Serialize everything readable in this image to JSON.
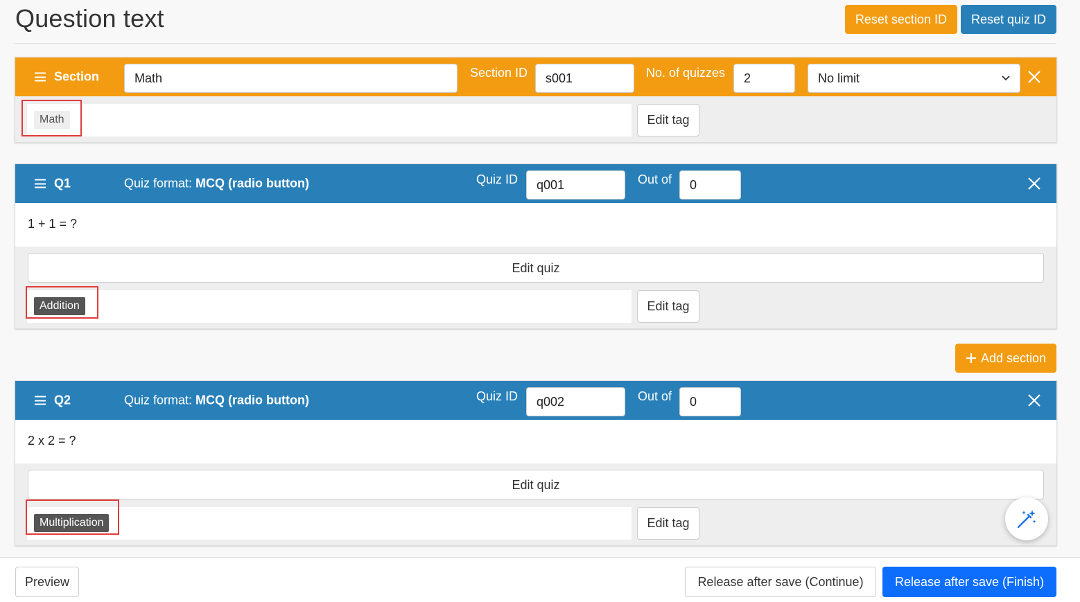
{
  "header": {
    "title": "Question text",
    "reset_section_label": "Reset section ID",
    "reset_quiz_label": "Reset quiz ID"
  },
  "section": {
    "label": "Section",
    "name_value": "Math",
    "section_id_label": "Section ID",
    "section_id_value": "s001",
    "num_quizzes_label": "No. of quizzes",
    "num_quizzes_value": "2",
    "limit_selected": "No limit",
    "tag": "Math",
    "edit_tag_label": "Edit tag"
  },
  "quizzes": [
    {
      "label": "Q1",
      "format_prefix": "Quiz format: ",
      "format_value": "MCQ (radio button)",
      "quiz_id_label": "Quiz ID",
      "quiz_id_value": "q001",
      "out_of_label": "Out of",
      "out_of_value": "0",
      "question": "1 + 1 = ?",
      "edit_quiz_label": "Edit quiz",
      "tag": "Addition",
      "edit_tag_label": "Edit tag"
    },
    {
      "label": "Q2",
      "format_prefix": "Quiz format: ",
      "format_value": "MCQ (radio button)",
      "quiz_id_label": "Quiz ID",
      "quiz_id_value": "q002",
      "out_of_label": "Out of",
      "out_of_value": "0",
      "question": "2 x 2 = ?",
      "edit_quiz_label": "Edit quiz",
      "tag": "Multiplication",
      "edit_tag_label": "Edit tag"
    }
  ],
  "add_section_label": "Add section",
  "footer": {
    "preview_label": "Preview",
    "release_continue_label": "Release after save (Continue)",
    "release_finish_label": "Release after save (Finish)"
  },
  "colors": {
    "orange": "#f39c12",
    "blue": "#2980b9",
    "primary": "#0d6efd",
    "highlight": "#e03c3c"
  },
  "icons": {
    "drag": "hamburger-icon",
    "close": "close-icon",
    "dropdown": "chevron-down-icon",
    "add": "plus-icon",
    "fab": "magic-wand-icon"
  }
}
